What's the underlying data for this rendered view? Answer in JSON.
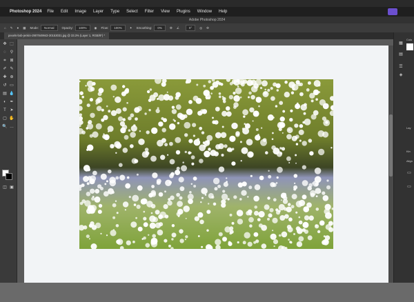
{
  "menu": {
    "apple": "",
    "app": "Photoshop 2024",
    "items": [
      "File",
      "Edit",
      "Image",
      "Layer",
      "Type",
      "Select",
      "Filter",
      "View",
      "Plugins",
      "Window",
      "Help"
    ]
  },
  "window_title": "Adobe Photoshop 2024",
  "options": {
    "mode_label": "Mode:",
    "mode_value": "Normal",
    "opacity_label": "Opacity:",
    "opacity_value": "100%",
    "flow_label": "Flow:",
    "flow_value": "100%",
    "smoothing_label": "Smoothing:",
    "smoothing_value": "0%",
    "angle_value": "0°"
  },
  "tab": {
    "label": "pexels-bob-jenkin-2907849943-30153031.jpg @ 33.3% (Layer 1, RGB/8*) *"
  },
  "right_panel": {
    "label1": "Colo",
    "label2": "Lay",
    "label3": "Kin",
    "label4": "Align"
  },
  "colors": {
    "menu_bg": "#1f1f1f",
    "ui_dark": "#3a3a3a",
    "canvas_bg": "#5a5a5a",
    "doc_bg": "#f2f4f6",
    "accent": "#6b4fcf"
  }
}
